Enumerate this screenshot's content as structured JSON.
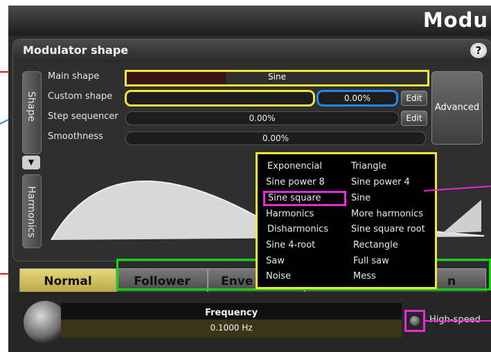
{
  "app": {
    "title": "Modu"
  },
  "panel": {
    "title": "Modulator shape",
    "help_label": "?"
  },
  "side_tabs": {
    "shape": "Shape",
    "harmonics": "Harmonics",
    "toggle_arrow": "▼"
  },
  "rows": {
    "main_shape": {
      "label": "Main shape",
      "value": "Sine"
    },
    "custom_shape": {
      "label": "Custom shape",
      "value": "0.00%",
      "edit_label": "Edit"
    },
    "step_sequencer": {
      "label": "Step sequencer",
      "value": "0.00%",
      "edit_label": "Edit"
    },
    "smoothness": {
      "label": "Smoothness",
      "value": "0.00%"
    }
  },
  "advanced_label": "Advanced",
  "dropdown": {
    "options": [
      "Exponencial",
      "Triangle",
      "Sine power 8",
      "Sine power 4",
      "Sine square",
      "Sine",
      "Harmonics",
      "More harmonics",
      "Disharmonics",
      "Sine square root",
      "Sine 4-root",
      "Rectangle",
      "Saw",
      "Full saw",
      "Noise",
      "Mess"
    ]
  },
  "mode_tabs": [
    "Normal",
    "Follower",
    "Enve",
    "n"
  ],
  "frequency": {
    "label": "Frequency",
    "value": "0.1000 Hz"
  },
  "high_speed_label": "High-speed",
  "colors": {
    "annotation_yellow": "#f3e53a",
    "annotation_blue": "#1f8bf0",
    "annotation_red": "#e01414",
    "annotation_green": "#16d40f",
    "annotation_magenta": "#e92bd6",
    "normal_tab": "#d8c766"
  }
}
